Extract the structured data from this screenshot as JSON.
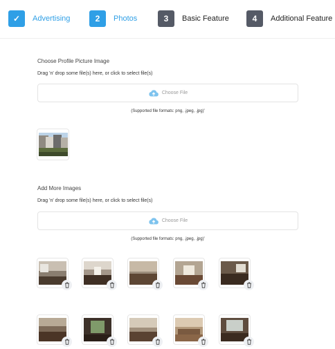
{
  "stepper": {
    "steps": [
      {
        "badge": "✓",
        "label": "Advertising",
        "state": "completed"
      },
      {
        "badge": "2",
        "label": "Photos",
        "state": "active"
      },
      {
        "badge": "3",
        "label": "Basic Feature",
        "state": "inactive"
      },
      {
        "badge": "4",
        "label": "Additional Feature",
        "state": "inactive"
      }
    ],
    "active_color": "#2f9fe6",
    "inactive_color": "#555a66"
  },
  "profile_section": {
    "title": "Choose Profile Picture Image",
    "hint": "Drag 'n' drop some file(s) here, or click to select file(s)",
    "choose_label": "Choose File",
    "formats": "(Supported file formats: png, .jpeg, .jpg)'"
  },
  "more_section": {
    "title": "Add More Images",
    "hint": "Drag 'n' drop some file(s) here, or click to select file(s)",
    "choose_label": "Choose File",
    "formats": "(Supported file formats: png, .jpeg, .jpg)'"
  },
  "icons": {
    "upload": "cloud-upload-icon",
    "delete": "trash-icon"
  }
}
